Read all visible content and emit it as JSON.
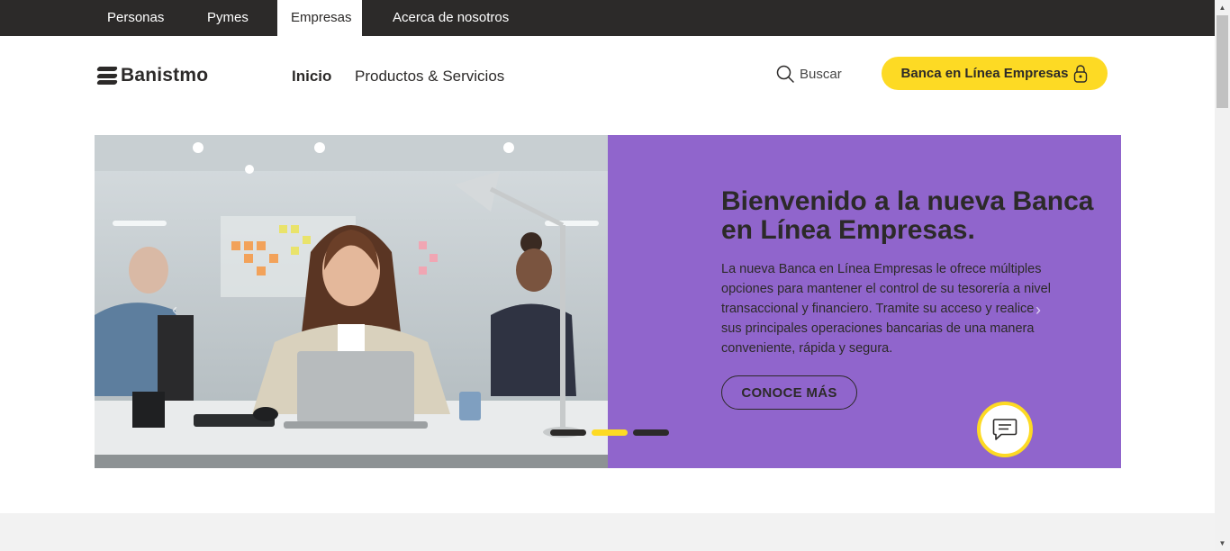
{
  "segments": [
    "Personas",
    "Pymes",
    "Empresas",
    "Acerca de nosotros"
  ],
  "active_segment": "Empresas",
  "header": {
    "logo_text": "Banistmo",
    "nav": [
      "Inicio",
      "Productos & Servicios"
    ],
    "search_label": "Buscar",
    "online_banking_label": "Banca en Línea Empresas"
  },
  "hero": {
    "title": "Bienvenido a la nueva Banca en Línea Empresas.",
    "description": "La nueva Banca en Línea Empresas le ofrece múltiples opciones para mantener el control de su tesorería a nivel transaccional y financiero. Tramite su acceso y realice sus principales operaciones bancarias de una manera conveniente, rápida y segura.",
    "cta_label": "CONOCE MÁS",
    "prev_arrow": "‹",
    "next_arrow": "›",
    "slides_total": 3,
    "active_slide": 2
  },
  "colors": {
    "dark": "#2c2a29",
    "brand_yellow": "#fdda24",
    "hero_purple": "#9065cc",
    "band_gray": "#f2f2f2"
  },
  "icons": {
    "search": "search-icon",
    "lock": "lock-icon",
    "chat": "chat-icon",
    "prev": "chevron-left-icon",
    "next": "chevron-right-icon"
  }
}
